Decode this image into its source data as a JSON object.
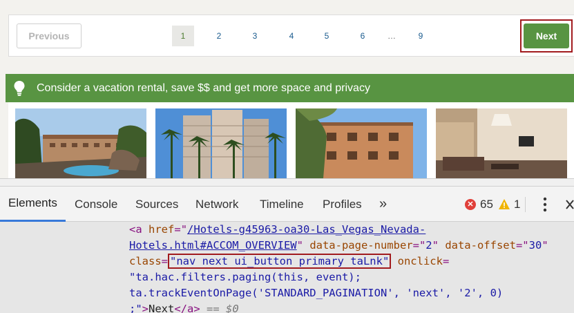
{
  "pagination": {
    "previous_label": "Previous",
    "pages": [
      "1",
      "2",
      "3",
      "4",
      "5",
      "6",
      "…",
      "9"
    ],
    "current_page": "1",
    "next_label": "Next"
  },
  "rental_banner": {
    "text": "Consider a vacation rental, save $$ and get more space and privacy",
    "icon": "lightbulb-icon"
  },
  "photos": [
    "hotel-pool-photo",
    "high-rise-palms-photo",
    "apartment-building-photo",
    "hotel-room-interior-photo"
  ],
  "devtools": {
    "tabs": [
      "Elements",
      "Console",
      "Sources",
      "Network",
      "Timeline",
      "Profiles"
    ],
    "active_tab": "Elements",
    "more_icon": "»",
    "error_count": "65",
    "warning_count": "1",
    "code": {
      "l1_open": "<",
      "l1_tag": "a",
      "l1_attr": " href",
      "l1_eq": "=\"",
      "l1_url": "/Hotels-g45963-oa30-Las_Vegas_Nevada-",
      "l2_url": "Hotels.html#ACCOM_OVERVIEW",
      "l2_q": "\"",
      "l2_attr1": " data-page-number",
      "l2_eq1": "=\"",
      "l2_val1": "2",
      "l2_q1": "\"",
      "l2_attr2": " data-offset",
      "l2_eq2": "=\"",
      "l2_val2": "30",
      "l2_q2": "\"",
      "l3_attr": "class",
      "l3_eq": "=",
      "l3_val": "\"nav next ui_button primary taLnk\"",
      "l3_attr2": " onclick",
      "l3_eq2": "=",
      "l4": "\"ta.hac.filters.paging(this, event);",
      "l5": "ta.trackEventOnPage('STANDARD_PAGINATION', 'next', '2', 0)",
      "l6_a": ";\"",
      "l6_b": ">",
      "l6_text": "Next",
      "l6_close": "</a>",
      "l6_eq": " == $0"
    }
  },
  "colors": {
    "brand_green": "#589442",
    "highlight_red": "#a11a1e",
    "devtools_accent": "#3879d9",
    "link_blue": "#1a5b8e"
  }
}
